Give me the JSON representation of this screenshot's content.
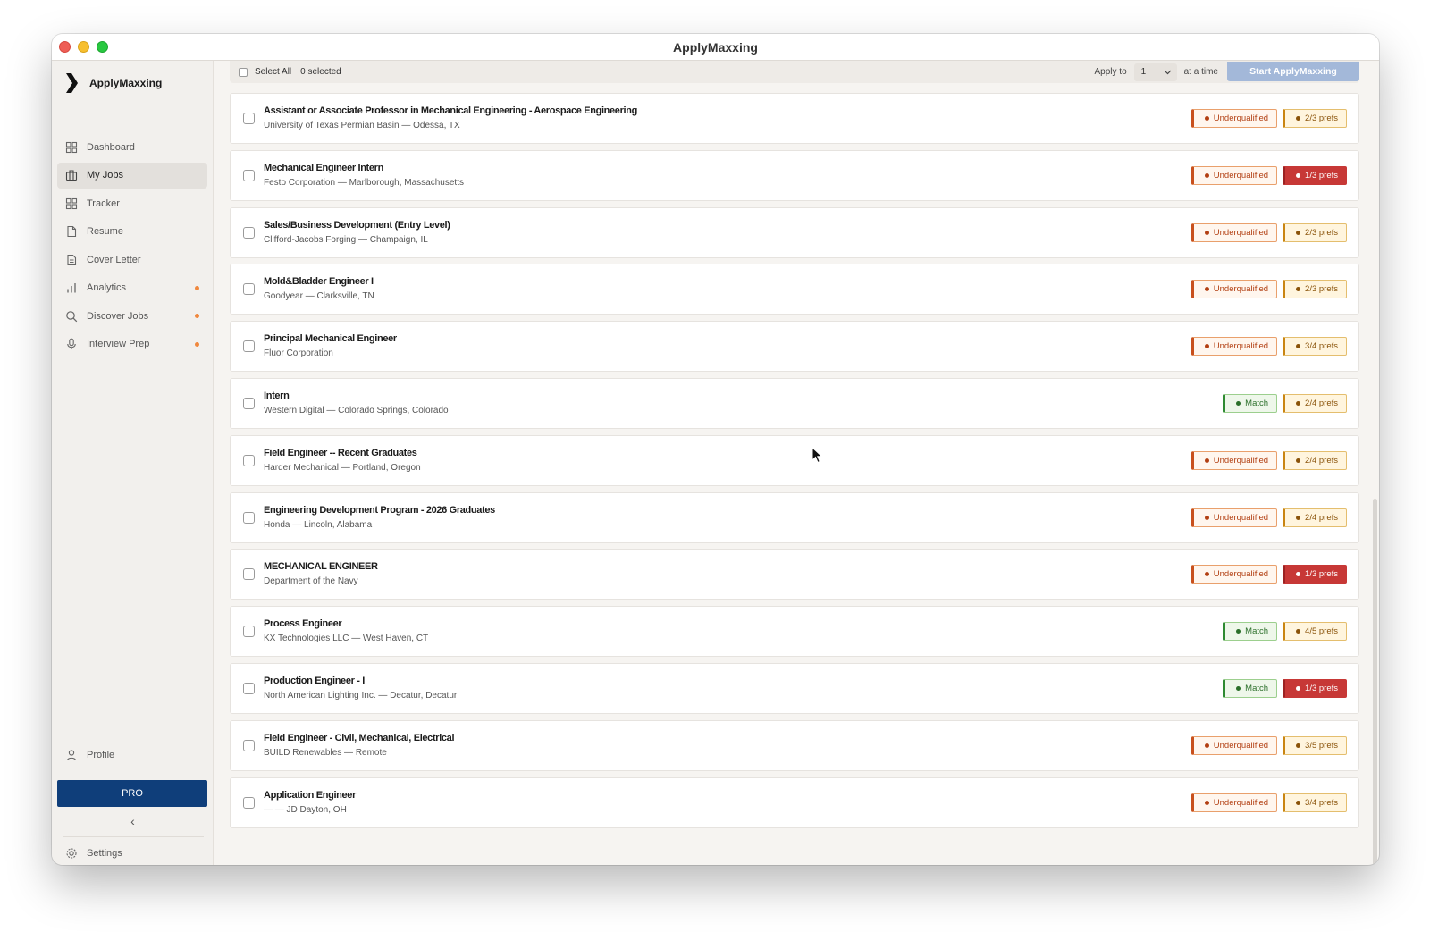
{
  "window": {
    "title": "ApplyMaxxing"
  },
  "sidebar": {
    "brand": "ApplyMaxxing",
    "items": [
      {
        "label": "Dashboard",
        "icon": "dashboard-icon"
      },
      {
        "label": "My Jobs",
        "icon": "briefcase-icon",
        "active": true
      },
      {
        "label": "Tracker",
        "icon": "tracker-icon"
      },
      {
        "label": "Resume",
        "icon": "document-icon"
      },
      {
        "label": "Cover Letter",
        "icon": "letter-icon"
      },
      {
        "label": "Analytics",
        "icon": "bar-chart-icon",
        "dot": true
      },
      {
        "label": "Discover Jobs",
        "icon": "search-icon",
        "dot": true
      },
      {
        "label": "Interview Prep",
        "icon": "microphone-icon",
        "dot": true
      }
    ],
    "profile": "Profile",
    "pro": "PRO",
    "collapse": "‹",
    "settings": "Settings"
  },
  "toolbar": {
    "select_all": "Select All",
    "selected": "0 selected",
    "apply_to": "Apply to",
    "apply_count": "1",
    "at_a_time": "at a time",
    "start": "Start ApplyMaxxing"
  },
  "jobs": [
    {
      "title": "Assistant or Associate Professor in Mechanical Engineering - Aerospace Engineering",
      "subtitle": "University of Texas Permian Basin — Odessa, TX",
      "status": "Underqualified",
      "prefs": "2/3 prefs",
      "prefs_low": false
    },
    {
      "title": "Mechanical Engineer Intern",
      "subtitle": "Festo Corporation — Marlborough, Massachusetts",
      "status": "Underqualified",
      "prefs": "1/3 prefs",
      "prefs_low": true
    },
    {
      "title": "Sales/Business Development (Entry Level)",
      "subtitle": "Clifford-Jacobs Forging — Champaign, IL",
      "status": "Underqualified",
      "prefs": "2/3 prefs",
      "prefs_low": false
    },
    {
      "title": "Mold&Bladder Engineer I",
      "subtitle": "Goodyear — Clarksville, TN",
      "status": "Underqualified",
      "prefs": "2/3 prefs",
      "prefs_low": false
    },
    {
      "title": "Principal Mechanical Engineer",
      "subtitle": "Fluor Corporation",
      "status": "Underqualified",
      "prefs": "3/4 prefs",
      "prefs_low": false
    },
    {
      "title": "Intern",
      "subtitle": "Western Digital — Colorado Springs, Colorado",
      "status": "Match",
      "prefs": "2/4 prefs",
      "prefs_low": false
    },
    {
      "title": "Field Engineer -- Recent Graduates",
      "subtitle": "Harder Mechanical — Portland, Oregon",
      "status": "Underqualified",
      "prefs": "2/4 prefs",
      "prefs_low": false
    },
    {
      "title": "Engineering Development Program - 2026 Graduates",
      "subtitle": "Honda — Lincoln, Alabama",
      "status": "Underqualified",
      "prefs": "2/4 prefs",
      "prefs_low": false
    },
    {
      "title": "MECHANICAL ENGINEER",
      "subtitle": "Department of the Navy",
      "status": "Underqualified",
      "prefs": "1/3 prefs",
      "prefs_low": true
    },
    {
      "title": "Process Engineer",
      "subtitle": "KX Technologies LLC — West Haven, CT",
      "status": "Match",
      "prefs": "4/5 prefs",
      "prefs_low": false
    },
    {
      "title": "Production Engineer - I",
      "subtitle": "North American Lighting Inc. — Decatur, Decatur",
      "status": "Match",
      "prefs": "1/3 prefs",
      "prefs_low": true
    },
    {
      "title": "Field Engineer - Civil, Mechanical, Electrical",
      "subtitle": "BUILD Renewables — Remote",
      "status": "Underqualified",
      "prefs": "3/5 prefs",
      "prefs_low": false
    },
    {
      "title": "Application Engineer",
      "subtitle": "— — JD Dayton, OH",
      "status": "Underqualified",
      "prefs": "3/4 prefs",
      "prefs_low": false
    }
  ]
}
